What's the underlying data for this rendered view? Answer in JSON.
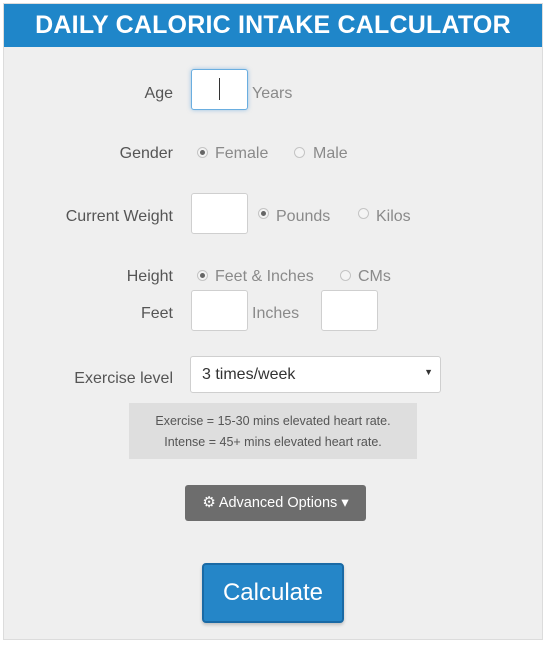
{
  "header": {
    "title": "DAILY CALORIC INTAKE CALCULATOR"
  },
  "age": {
    "label": "Age",
    "value": "",
    "unit": "Years"
  },
  "gender": {
    "label": "Gender",
    "options": [
      "Female",
      "Male"
    ],
    "selected": "Female"
  },
  "weight": {
    "label": "Current Weight",
    "value": "",
    "units": [
      "Pounds",
      "Kilos"
    ],
    "selected": "Pounds"
  },
  "height": {
    "label": "Height",
    "units": [
      "Feet & Inches",
      "CMs"
    ],
    "selected": "Feet & Inches",
    "feet_label": "Feet",
    "feet_value": "",
    "inches_label": "Inches",
    "inches_value": ""
  },
  "exercise": {
    "label": "Exercise level",
    "selected": "3 times/week"
  },
  "note": {
    "line1": "Exercise = 15-30 mins elevated heart rate.",
    "line2": "Intense = 45+ mins elevated heart rate."
  },
  "advanced": {
    "label": "Advanced Options ▾"
  },
  "calculate": {
    "label": "Calculate"
  },
  "colors": {
    "accent": "#1f86c9",
    "button_gray": "#6d6d6d",
    "background": "#efefef"
  },
  "icons": {
    "advanced": "gear-icon",
    "select": "chevron-down-icon"
  }
}
